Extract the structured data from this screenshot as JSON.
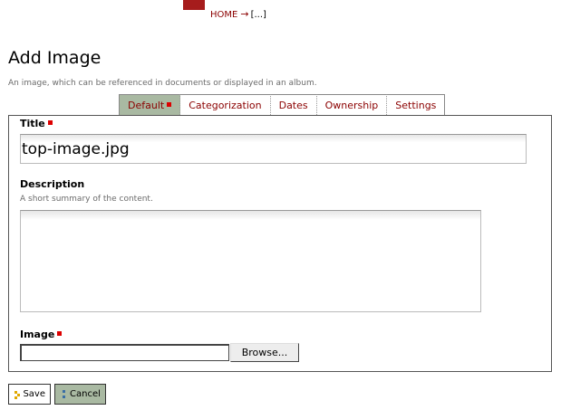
{
  "breadcrumb": {
    "home": "HOME",
    "arrow": "→",
    "current": "[...]"
  },
  "page": {
    "title": "Add Image",
    "description": "An image, which can be referenced in documents or displayed in an album."
  },
  "tabs": [
    {
      "label": "Default",
      "active": true,
      "required": true
    },
    {
      "label": "Categorization",
      "active": false
    },
    {
      "label": "Dates",
      "active": false
    },
    {
      "label": "Ownership",
      "active": false
    },
    {
      "label": "Settings",
      "active": false
    }
  ],
  "form": {
    "title_label": "Title",
    "title_value": "top-image.jpg",
    "description_label": "Description",
    "description_help": "A short summary of the content.",
    "description_value": "",
    "image_label": "Image",
    "image_path": "",
    "browse_label": "Browse..."
  },
  "actions": {
    "save_label": "Save",
    "cancel_label": "Cancel"
  },
  "colors": {
    "accent_red": "#8b0000",
    "required_marker": "#dd0000",
    "active_tab_bg": "#a9b9a2",
    "logo_block": "#a61c1c"
  }
}
